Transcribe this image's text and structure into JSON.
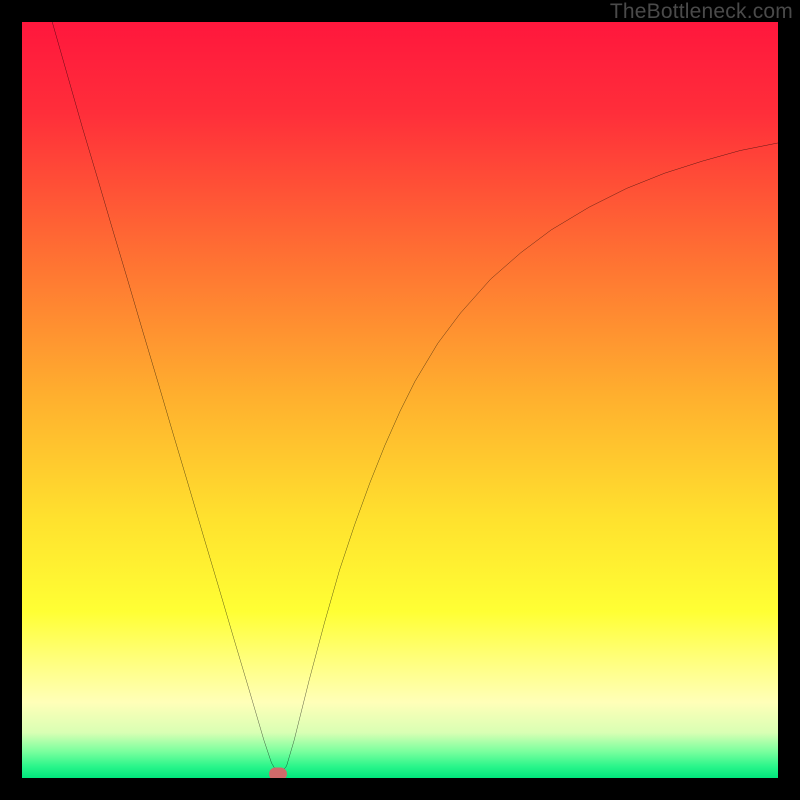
{
  "watermark": "TheBottleneck.com",
  "chart_data": {
    "type": "line",
    "title": "",
    "xlabel": "",
    "ylabel": "",
    "xlim": [
      0,
      100
    ],
    "ylim": [
      0,
      100
    ],
    "grid": false,
    "background_gradient": {
      "stops": [
        {
          "pct": 0,
          "color": "#ff173d"
        },
        {
          "pct": 12,
          "color": "#ff2e3a"
        },
        {
          "pct": 30,
          "color": "#ff6d33"
        },
        {
          "pct": 50,
          "color": "#ffb12e"
        },
        {
          "pct": 66,
          "color": "#ffe22e"
        },
        {
          "pct": 78,
          "color": "#ffff34"
        },
        {
          "pct": 84,
          "color": "#ffff78"
        },
        {
          "pct": 90,
          "color": "#ffffb8"
        },
        {
          "pct": 94,
          "color": "#d9ffb4"
        },
        {
          "pct": 96.5,
          "color": "#7aff9e"
        },
        {
          "pct": 98.5,
          "color": "#29f58a"
        },
        {
          "pct": 100,
          "color": "#00e57c"
        }
      ]
    },
    "series": [
      {
        "name": "bottleneck-curve",
        "color": "#000000",
        "width": 2,
        "x": [
          4.0,
          6.0,
          8.0,
          10.0,
          12.0,
          14.0,
          16.0,
          18.0,
          20.0,
          22.0,
          24.0,
          26.0,
          28.0,
          30.0,
          31.0,
          32.0,
          33.0,
          34.0,
          35.0,
          36.0,
          38.0,
          40.0,
          42.0,
          44.0,
          46.0,
          48.0,
          50.0,
          52.0,
          55.0,
          58.0,
          62.0,
          66.0,
          70.0,
          75.0,
          80.0,
          85.0,
          90.0,
          95.0,
          100.0
        ],
        "y": [
          100.0,
          93.0,
          86.0,
          79.3,
          72.5,
          65.8,
          59.0,
          52.3,
          45.5,
          38.8,
          32.0,
          25.3,
          18.5,
          11.8,
          8.4,
          5.0,
          2.0,
          0.3,
          1.6,
          5.0,
          13.0,
          20.5,
          27.5,
          33.5,
          39.0,
          44.0,
          48.5,
          52.5,
          57.5,
          61.5,
          66.0,
          69.5,
          72.5,
          75.5,
          78.0,
          80.0,
          81.6,
          83.0,
          84.0
        ]
      }
    ],
    "marker": {
      "name": "optimal-point",
      "x": 33.8,
      "y": 0.5,
      "color": "#cf6a6a"
    }
  }
}
